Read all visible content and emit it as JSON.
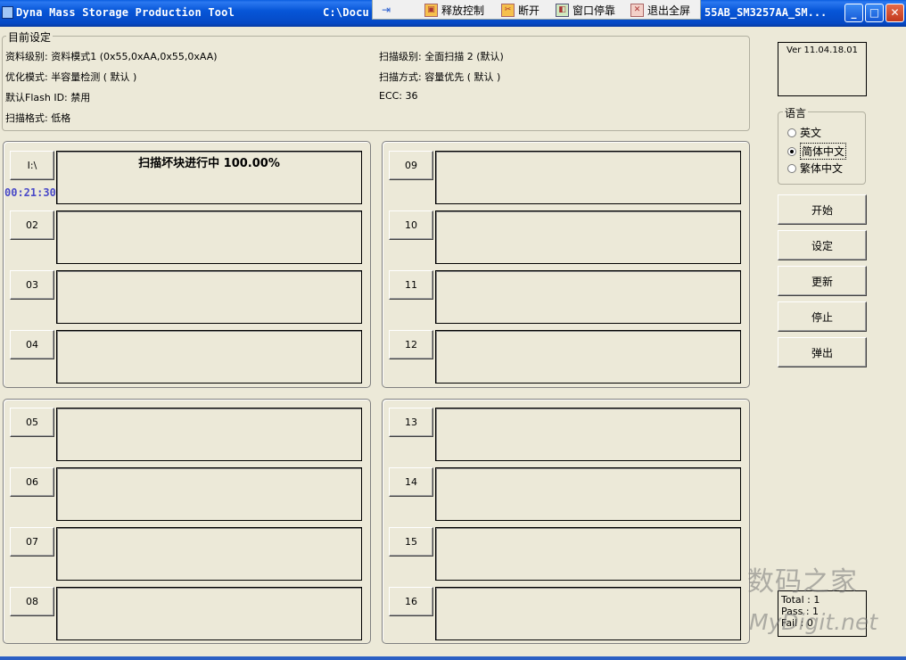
{
  "window": {
    "title_left": "Dyna Mass Storage Production Tool",
    "title_path": "C:\\Docu",
    "title_right": "55AB_SM3257AA_SM...",
    "minimize": "_",
    "maximize": "□",
    "close": "✕"
  },
  "remote_toolbar": {
    "pin": "⇥",
    "release_control": "释放控制",
    "disconnect": "断开",
    "dock_window": "窗口停靠",
    "exit_fullscreen": "退出全屏"
  },
  "current_settings": {
    "legend": "目前设定",
    "data_level": "资料级别: 资料模式1 (0x55,0xAA,0x55,0xAA)",
    "optimize_mode": "优化模式: 半容量检测 ( 默认 )",
    "default_flash_id": "默认Flash ID: 禁用",
    "scan_format": "扫描格式: 低格",
    "scan_level": "扫描级别: 全面扫描 2 (默认)",
    "scan_method": "扫描方式: 容量优先 ( 默认 )",
    "ecc": "ECC: 36"
  },
  "version": "Ver 11.04.18.01",
  "language": {
    "legend": "语言",
    "options": [
      "英文",
      "简体中文",
      "繁体中文"
    ],
    "selected_index": 1
  },
  "buttons": {
    "start": "开始",
    "settings": "设定",
    "update": "更新",
    "stop": "停止",
    "eject": "弹出"
  },
  "slots": [
    {
      "label": "I:\\",
      "status": "扫描坏块进行中  100.00%"
    },
    {
      "label": "02",
      "status": ""
    },
    {
      "label": "03",
      "status": ""
    },
    {
      "label": "04",
      "status": ""
    },
    {
      "label": "05",
      "status": ""
    },
    {
      "label": "06",
      "status": ""
    },
    {
      "label": "07",
      "status": ""
    },
    {
      "label": "08",
      "status": ""
    },
    {
      "label": "09",
      "status": ""
    },
    {
      "label": "10",
      "status": ""
    },
    {
      "label": "11",
      "status": ""
    },
    {
      "label": "12",
      "status": ""
    },
    {
      "label": "13",
      "status": ""
    },
    {
      "label": "14",
      "status": ""
    },
    {
      "label": "15",
      "status": ""
    },
    {
      "label": "16",
      "status": ""
    }
  ],
  "timer": "00:21:30",
  "stats": {
    "total": "Total : 1",
    "pass": "Pass : 1",
    "fail": "Fail : 0"
  },
  "watermark": {
    "line1": "数码之家",
    "line2": "MyDigit.net"
  },
  "colors": {
    "titlebar": "#0756d8",
    "face": "#ece9d8",
    "timer": "#4a4ac8"
  }
}
